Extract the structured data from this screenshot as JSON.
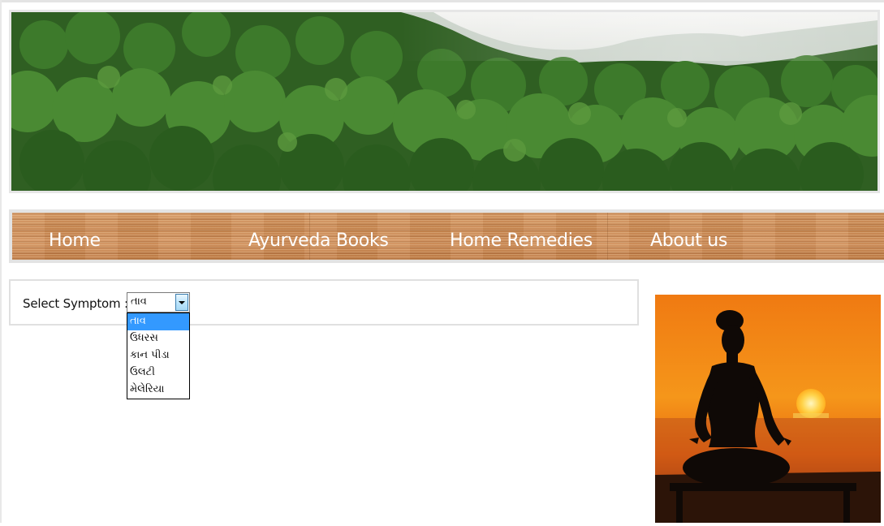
{
  "nav": {
    "items": [
      {
        "label": "Home"
      },
      {
        "label": "Ayurveda Books"
      },
      {
        "label": "Home Remedies"
      },
      {
        "label": "About us"
      }
    ]
  },
  "symptom": {
    "label": "Select Symptom :",
    "selected": "તાવ",
    "options": [
      "તાવ",
      "ઉધરસ",
      "કાન પીડા",
      "ઉલટી",
      "મેલેરિયા"
    ],
    "highlight_color": "#3399ff"
  },
  "images": {
    "banner": "forest-canopy-banner",
    "side": "meditation-silhouette-at-sunset"
  }
}
